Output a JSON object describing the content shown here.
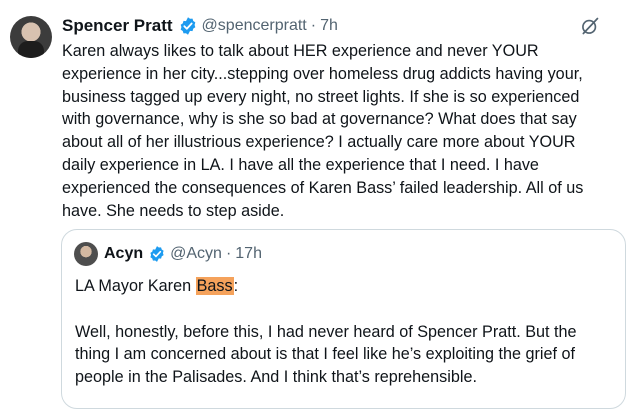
{
  "post": {
    "author_name": "Spencer Pratt",
    "handle": "@spencerpratt",
    "separator": "·",
    "time": "7h",
    "avatar_icon": "profile-photo",
    "text_lines": [
      "Karen always likes to talk about HER experience and never YOUR",
      "experience in her city...stepping over homeless drug addicts having your,",
      "business tagged up every night, no street lights. If she is so experienced",
      "with governance, why is she so bad at governance? What does that say",
      "about all of her illustrious experience? I actually care more about YOUR",
      "daily experience in LA. I have all the experience that I need. I have",
      "experienced the consequences of Karen Bass’ failed leadership. All of us",
      "have. She needs to step aside."
    ]
  },
  "quote": {
    "author_name": "Acyn",
    "handle": "@Acyn",
    "separator": "·",
    "time": "17h",
    "first_line_prefix": "LA Mayor Karen ",
    "first_line_highlight": "Bass",
    "first_line_suffix": ":",
    "body_lines": [
      "Well, honestly, before this, I had never heard of Spencer Pratt. But the",
      "thing I am concerned about is that I feel like he’s exploiting the grief of",
      "people in the Palisades. And I think that’s reprehensible."
    ]
  },
  "colors": {
    "text": "#0f1419",
    "secondary": "#536471",
    "verified_blue": "#1d9bf0",
    "highlight": "#f5a25b",
    "border": "#cfd9de"
  }
}
